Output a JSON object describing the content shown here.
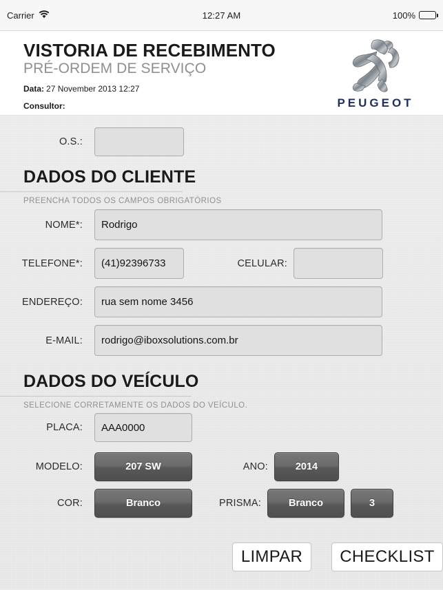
{
  "status_bar": {
    "carrier": "Carrier",
    "wifi_icon": "wifi-icon",
    "time": "12:27 AM",
    "battery_percent": "100%",
    "battery_icon": "battery-full-icon"
  },
  "header": {
    "title": "VISTORIA DE RECEBIMENTO",
    "subtitle": "PRÉ-ORDEM DE SERVIÇO",
    "date_label": "Data:",
    "date_value": "27 November 2013 12:27",
    "consultant_label": "Consultor:",
    "consultant_value": "",
    "logo": {
      "name": "peugeot-logo",
      "wordmark": "PEUGEOT",
      "wordmark_color": "#1d2f5a"
    }
  },
  "form": {
    "os": {
      "label": "O.S.:",
      "value": "",
      "placeholder": ""
    },
    "client_section": {
      "title": "DADOS DO CLIENTE",
      "subtitle": "PREENCHA TODOS OS CAMPOS OBRIGATÓRIOS",
      "fields": {
        "nome": {
          "label": "NOME*:",
          "value": "Rodrigo",
          "placeholder": ""
        },
        "telefone": {
          "label": "TELEFONE*:",
          "value": "(41)92396733",
          "placeholder": ""
        },
        "celular": {
          "label": "CELULAR:",
          "value": "",
          "placeholder": ""
        },
        "endereco": {
          "label": "ENDEREÇO:",
          "value": "rua sem nome 3456",
          "placeholder": ""
        },
        "email": {
          "label": "E-MAIL:",
          "value": "rodrigo@iboxsolutions.com.br",
          "placeholder": ""
        }
      }
    },
    "vehicle_section": {
      "title": "DADOS DO VEÍCULO",
      "subtitle": "SELECIONE CORRETAMENTE OS DADOS DO VEÍCULO.",
      "fields": {
        "placa": {
          "label": "PLACA:",
          "value": "AAA0000",
          "placeholder": ""
        },
        "modelo": {
          "label": "MODELO:",
          "value": "207 SW"
        },
        "ano": {
          "label": "ANO:",
          "value": "2014"
        },
        "cor": {
          "label": "COR:",
          "value": "Branco"
        },
        "prisma": {
          "label": "PRISMA:",
          "value": "Branco",
          "count": "3"
        }
      }
    }
  },
  "actions": {
    "clear": "LIMPAR",
    "checklist": "CHECKLIST"
  },
  "colors": {
    "background": "#ececec",
    "input_fill": "#e0e0e0",
    "input_border": "#aeaeae",
    "button_dark_top": "#787878",
    "button_dark_bottom": "#4f4f4f",
    "brand": "#1d2f5a"
  }
}
